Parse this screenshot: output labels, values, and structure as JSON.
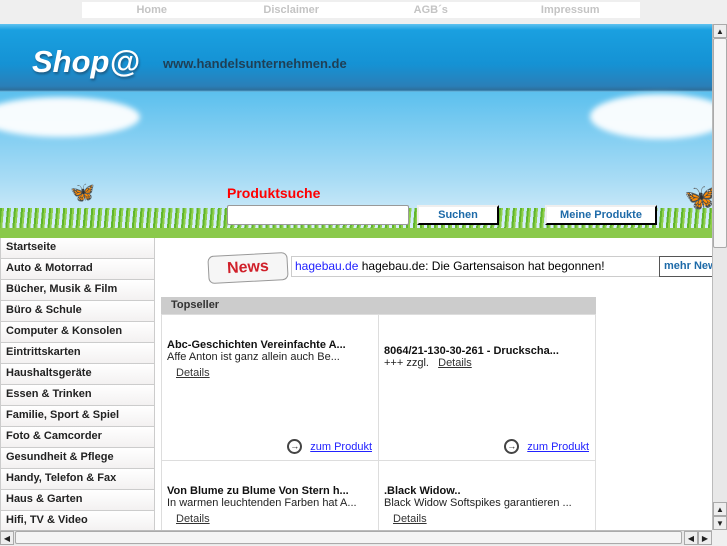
{
  "topnav": [
    "Home",
    "Disclaimer",
    "AGB´s",
    "Impressum"
  ],
  "header": {
    "logo": "Shop@",
    "url": "www.handelsunternehmen.de"
  },
  "search": {
    "label": "Produktsuche",
    "value": "",
    "button": "Suchen",
    "my_products": "Meine Produkte"
  },
  "sidebar": [
    "Startseite",
    "Auto & Motorrad",
    "Bücher, Musik & Film",
    "Büro & Schule",
    "Computer & Konsolen",
    "Eintrittskarten",
    "Haushaltsgeräte",
    "Essen & Trinken",
    "Familie, Sport & Spiel",
    "Foto & Camcorder",
    "Gesundheit & Pflege",
    "Handy, Telefon & Fax",
    "Haus & Garten",
    "Hifi, TV & Video"
  ],
  "news": {
    "badge": "News",
    "link": "hagebau.de",
    "text": " hagebau.de: Die Gartensaison hat begonnen!",
    "more": "mehr News"
  },
  "topseller": {
    "title": "Topseller",
    "products": [
      {
        "title": "Abc-Geschichten Vereinfachte A...",
        "desc": "Affe Anton ist ganz allein auch Be...",
        "details": "Details",
        "link": "zum Produkt"
      },
      {
        "title": "8064/21-130-30-261 - Druckscha...",
        "desc": "+++ zzgl.",
        "details": "Details",
        "link": "zum Produkt"
      },
      {
        "title": "Von Blume zu Blume Von Stern h...",
        "desc": "In warmen leuchtenden Farben hat A...",
        "details": "Details"
      },
      {
        "title": ".Black Widow..",
        "desc": "Black Widow Softspikes garantieren ...",
        "details": "Details"
      }
    ]
  }
}
